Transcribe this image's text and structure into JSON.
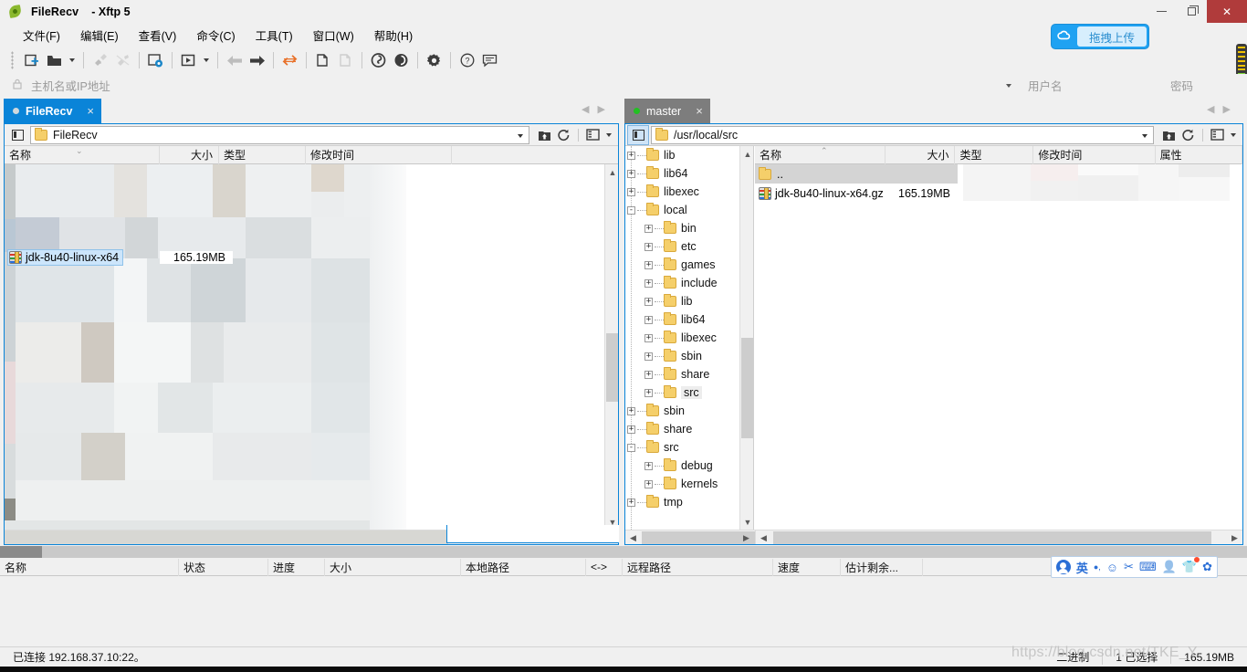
{
  "window": {
    "app_icon": "leaf-icon",
    "title": "FileRecv",
    "subtitle": "- Xftp 5",
    "minimize_label": "minimize-icon",
    "maximize_label": "maximize-icon",
    "close_label": "✕"
  },
  "menu": {
    "items": [
      "文件(F)",
      "编辑(E)",
      "查看(V)",
      "命令(C)",
      "工具(T)",
      "窗口(W)",
      "帮助(H)"
    ]
  },
  "toolbar": {
    "buttons": [
      {
        "name": "new-session-icon",
        "glyph": "⊞",
        "disabled": false
      },
      {
        "name": "open-folder-icon",
        "glyph": "📁",
        "disabled": false
      },
      {
        "name": "open-dropdown-caret",
        "glyph": "▾",
        "disabled": false
      },
      {
        "name": "connect-icon",
        "glyph": "⚯",
        "disabled": true
      },
      {
        "name": "disconnect-icon",
        "glyph": "⚯",
        "disabled": true
      },
      {
        "name": "session-settings-icon",
        "glyph": "⚙",
        "disabled": false
      },
      {
        "name": "run-icon",
        "glyph": "▶",
        "disabled": false
      },
      {
        "name": "run-dropdown-caret",
        "glyph": "▾",
        "disabled": false
      },
      {
        "name": "back-icon",
        "glyph": "←",
        "disabled": true
      },
      {
        "name": "forward-icon",
        "glyph": "→",
        "disabled": false
      },
      {
        "name": "sync-browse-icon",
        "glyph": "⇄",
        "disabled": false
      },
      {
        "name": "copy-icon",
        "glyph": "⧉",
        "disabled": false
      },
      {
        "name": "paste-icon",
        "glyph": "⧉",
        "disabled": true
      },
      {
        "name": "xshell-icon",
        "glyph": "◉",
        "disabled": false
      },
      {
        "name": "xftp-icon",
        "glyph": "◑",
        "disabled": false
      },
      {
        "name": "options-gear-icon",
        "glyph": "✿",
        "disabled": false
      },
      {
        "name": "help-icon",
        "glyph": "?",
        "disabled": false
      },
      {
        "name": "feedback-icon",
        "glyph": "▭",
        "disabled": false
      }
    ],
    "drag_upload_label": "拖拽上传",
    "drag_upload_icon": "cloud-upload-icon"
  },
  "connection": {
    "host_placeholder": "主机名或IP地址",
    "host_value": "",
    "username_placeholder": "用户名",
    "username_value": "",
    "password_placeholder": "密码",
    "password_value": "",
    "lock_icon": "lock-icon"
  },
  "local_panel": {
    "tab": {
      "label": "FileRecv",
      "status_dot": "grey",
      "close": "×"
    },
    "path": "FileRecv",
    "columns": [
      {
        "label": "名称",
        "width": 170,
        "align": "left"
      },
      {
        "label": "大小",
        "width": 65,
        "align": "right"
      },
      {
        "label": "类型",
        "width": 95,
        "align": "left"
      },
      {
        "label": "修改时间",
        "width": 160,
        "align": "left"
      }
    ],
    "files": [
      {
        "name": "jdk-8u40-linux-x64",
        "size": "165.19MB",
        "type": "",
        "modified": "",
        "icon": "archive-icon",
        "selected": true
      }
    ],
    "toolbar_buttons": [
      "upload-icon",
      "refresh-icon",
      "view-mode-icon",
      "view-dropdown-caret"
    ],
    "panel_toggle_icon": "split-view-icon"
  },
  "remote_panel": {
    "tab": {
      "label": "master",
      "status_dot": "green",
      "close": "×"
    },
    "path": "/usr/local/src",
    "columns": [
      {
        "label": "名称",
        "width": 150,
        "align": "left"
      },
      {
        "label": "大小",
        "width": 80,
        "align": "right"
      },
      {
        "label": "类型",
        "width": 90,
        "align": "left"
      },
      {
        "label": "修改时间",
        "width": 140,
        "align": "left"
      },
      {
        "label": "属性",
        "width": 100,
        "align": "left"
      }
    ],
    "files": [
      {
        "name": "..",
        "size": "",
        "type": "",
        "modified": "",
        "icon": "folder-icon",
        "selected": true
      },
      {
        "name": "jdk-8u40-linux-x64.gz",
        "size": "165.19MB",
        "type": "",
        "modified": "",
        "icon": "archive-icon",
        "selected": false
      }
    ],
    "toolbar_buttons": [
      "upload-icon",
      "refresh-icon",
      "view-mode-icon",
      "view-dropdown-caret"
    ],
    "panel_toggle_icon": "split-view-icon",
    "tree": [
      {
        "label": "lib",
        "depth": 1,
        "expander": "+"
      },
      {
        "label": "lib64",
        "depth": 1,
        "expander": "+"
      },
      {
        "label": "libexec",
        "depth": 1,
        "expander": "+"
      },
      {
        "label": "local",
        "depth": 1,
        "expander": "-"
      },
      {
        "label": "bin",
        "depth": 2,
        "expander": "+"
      },
      {
        "label": "etc",
        "depth": 2,
        "expander": "+"
      },
      {
        "label": "games",
        "depth": 2,
        "expander": "+"
      },
      {
        "label": "include",
        "depth": 2,
        "expander": "+"
      },
      {
        "label": "lib",
        "depth": 2,
        "expander": "+"
      },
      {
        "label": "lib64",
        "depth": 2,
        "expander": "+"
      },
      {
        "label": "libexec",
        "depth": 2,
        "expander": "+"
      },
      {
        "label": "sbin",
        "depth": 2,
        "expander": "+"
      },
      {
        "label": "share",
        "depth": 2,
        "expander": "+"
      },
      {
        "label": "src",
        "depth": 2,
        "expander": "+",
        "selected": true
      },
      {
        "label": "sbin",
        "depth": 1,
        "expander": "+"
      },
      {
        "label": "share",
        "depth": 1,
        "expander": "+"
      },
      {
        "label": "src",
        "depth": 1,
        "expander": "-"
      },
      {
        "label": "debug",
        "depth": 2,
        "expander": "+"
      },
      {
        "label": "kernels",
        "depth": 2,
        "expander": "+"
      },
      {
        "label": "tmp",
        "depth": 1,
        "expander": "+"
      }
    ]
  },
  "transfer": {
    "columns": [
      {
        "label": "名称",
        "width": 196
      },
      {
        "label": "状态",
        "width": 98
      },
      {
        "label": "进度",
        "width": 62
      },
      {
        "label": "大小",
        "width": 149
      },
      {
        "label": "本地路径",
        "width": 137
      },
      {
        "label": "<->",
        "width": 40
      },
      {
        "label": "远程路径",
        "width": 165
      },
      {
        "label": "速度",
        "width": 74
      },
      {
        "label": "估计剩余...",
        "width": 90
      }
    ],
    "rows": []
  },
  "ime": {
    "icons": [
      "user-avatar-icon",
      "chinese-eng-toggle-icon",
      "half-width-icon",
      "emoji-icon",
      "scissors-icon",
      "keyboard-icon",
      "person-icon",
      "skin-icon",
      "settings-gear-icon"
    ],
    "lang_label": "英"
  },
  "statusbar": {
    "connected_text": "已连接 192.168.37.10:22。",
    "transfer_mode": "二进制",
    "selection": "1 已选择",
    "selection_size": "165.19MB"
  },
  "watermark": "https://blog.csdn.net/TKE_Y"
}
